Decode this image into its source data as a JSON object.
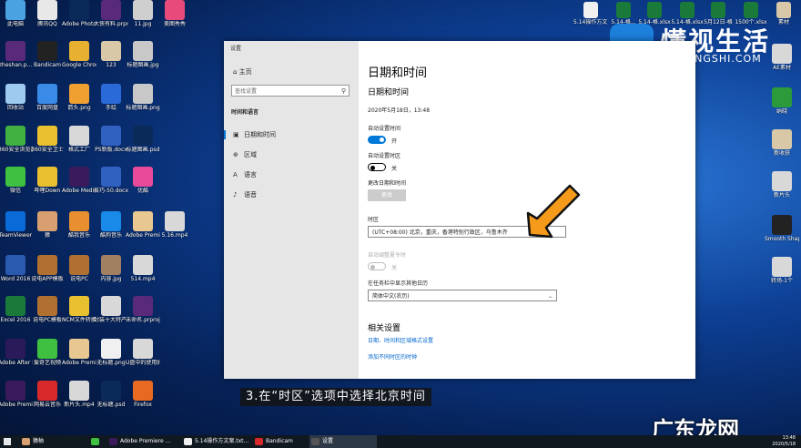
{
  "desktop_icons": [
    {
      "label": "此电脑",
      "color": "#4aa3e0"
    },
    {
      "label": "腾讯QQ",
      "color": "#e8e8e8"
    },
    {
      "label": "Adobe Photosh...",
      "color": "#0a2a5a"
    },
    {
      "label": "大侠有料.prproj",
      "color": "#5a2a7a"
    },
    {
      "label": "11.jpg",
      "color": "#cfcfcf"
    },
    {
      "label": "美图秀秀",
      "color": "#e84a7a"
    },
    {
      "label": "zheshan.p...",
      "color": "#5a2a7a"
    },
    {
      "label": "Bandicam",
      "color": "#222"
    },
    {
      "label": "Google Chrome",
      "color": "#e8b030"
    },
    {
      "label": "123",
      "color": "#d8c8a8"
    },
    {
      "label": "标题图画.jpg",
      "color": "#c8c8c8"
    },
    {
      "label": "回收站",
      "color": "#9ecaf0"
    },
    {
      "label": "百度网盘",
      "color": "#3a8ae8"
    },
    {
      "label": "箭头.png",
      "color": "#f0a030"
    },
    {
      "label": "手绘",
      "color": "#2a6ad8"
    },
    {
      "label": "标题图画.png",
      "color": "#c8c8c8"
    },
    {
      "label": "360安全浏览器",
      "color": "#40b040"
    },
    {
      "label": "360安全卫士",
      "color": "#e8c030"
    },
    {
      "label": "格式工厂",
      "color": "#d8d8d8"
    },
    {
      "label": "PS新版.docx",
      "color": "#3060c0"
    },
    {
      "label": "标题图画.psd",
      "color": "#0a2a5a"
    },
    {
      "label": "微信",
      "color": "#40c040"
    },
    {
      "label": "哔哩Down",
      "color": "#e8c030"
    },
    {
      "label": "Adobe Media...",
      "color": "#3a1a5a"
    },
    {
      "label": "技巧-50.docx",
      "color": "#3060c0"
    },
    {
      "label": "优酷",
      "color": "#e84a9a"
    },
    {
      "label": "TeamViewer",
      "color": "#0a6ad8"
    },
    {
      "label": "猿",
      "color": "#d8a070"
    },
    {
      "label": "酷我音乐",
      "color": "#e89030"
    },
    {
      "label": "酷狗音乐",
      "color": "#1a8ae8"
    },
    {
      "label": "Adobe Premier...",
      "color": "#e8c890"
    },
    {
      "label": "5.16.mp4",
      "color": "#d8d8d8"
    },
    {
      "label": "Word 2016",
      "color": "#2a5ab0"
    },
    {
      "label": "说电APP模板",
      "color": "#b07030"
    },
    {
      "label": "说电PC",
      "color": "#b07030"
    },
    {
      "label": "内容.jpg",
      "color": "#a08060"
    },
    {
      "label": "514.mp4",
      "color": "#d8d8d8"
    },
    {
      "label": "Excel 2016",
      "color": "#1a7a3a"
    },
    {
      "label": "说电PC模板",
      "color": "#b07030"
    },
    {
      "label": "NCM文件转换.exe",
      "color": "#e8c030"
    },
    {
      "label": "封装十大特产.mp4",
      "color": "#d8d8d8"
    },
    {
      "label": "未命名.prproj",
      "color": "#5a2a7a"
    },
    {
      "label": "Adobe After Effects 2020",
      "color": "#2a1a5a"
    },
    {
      "label": "爱奇艺视频",
      "color": "#40c040"
    },
    {
      "label": "Adobe Premier...",
      "color": "#e8c890"
    },
    {
      "label": "无标题.png",
      "color": "#f0f0f0"
    },
    {
      "label": "U盘中的使用好方法...",
      "color": "#d8d8d8"
    },
    {
      "label": "Adobe Premie...",
      "color": "#3a1a5a"
    },
    {
      "label": "网易云音乐",
      "color": "#d82a2a"
    },
    {
      "label": "新片头.mp4",
      "color": "#d8d8d8"
    },
    {
      "label": "无标题.psd",
      "color": "#0a2a5a"
    },
    {
      "label": "Firefox",
      "color": "#e86a20"
    }
  ],
  "right_icons": [
    {
      "label": "5.14操作方文.txt",
      "color": "#f0f0f0"
    },
    {
      "label": "5.14-格...",
      "color": "#1a7a3a"
    },
    {
      "label": "5.14-格.xlsx",
      "color": "#1a7a3a"
    },
    {
      "label": "5.14-格.xlsx",
      "color": "#1a7a3a"
    },
    {
      "label": "5月12日-格",
      "color": "#1a7a3a"
    },
    {
      "label": "1500个.xlsx",
      "color": "#1a7a3a"
    },
    {
      "label": "素材",
      "color": "#d8c8a8"
    },
    {
      "label": "AE素材",
      "color": "#d8d8d8"
    },
    {
      "label": "纳晓",
      "color": "#2a9a3a"
    },
    {
      "label": "新收获",
      "color": "#d8c8a8"
    },
    {
      "label": "新片头",
      "color": "#d8d8d8"
    },
    {
      "label": "Smooth Shapes...",
      "color": "#222"
    },
    {
      "label": "转场-1个",
      "color": "#d8d8d8"
    }
  ],
  "watermark": {
    "title": "懂视生活",
    "subtitle": "51DONGSHI.COM"
  },
  "settings": {
    "window_title": "设置",
    "home": "主页",
    "search_placeholder": "查找设置",
    "category": "时间和语言",
    "nav": [
      {
        "icon": "▣",
        "label": "日期和时间",
        "selected": true
      },
      {
        "icon": "⊕",
        "label": "区域",
        "selected": false
      },
      {
        "icon": "A",
        "label": "语言",
        "selected": false
      },
      {
        "icon": "♪",
        "label": "语音",
        "selected": false
      }
    ],
    "page_title": "日期和时间",
    "section_title": "日期和时间",
    "current_datetime": "2020年5月18日，13:48",
    "auto_time_label": "自动设置时间",
    "auto_time_state": "开",
    "auto_zone_label": "自动设置时区",
    "auto_zone_state": "关",
    "change_label": "更改日期和时间",
    "change_button": "更改",
    "timezone_label": "时区",
    "timezone_value": "(UTC+08:00) 北京，重庆，香港特别行政区，乌鲁木齐",
    "dst_label": "自动调整夏令时",
    "dst_state": "关",
    "calendar_label": "在任务栏中显示其他日历",
    "calendar_value": "简体中文(农历)",
    "related_title": "相关设置",
    "link1": "日期、时间和区域格式设置",
    "link2": "添加不同时区的时钟"
  },
  "caption": "3.在“时区”选项中选择北京时间",
  "brand": "广东龙网",
  "taskbar": {
    "items": [
      {
        "label": "猿柚",
        "color": "#d8a070"
      },
      {
        "label": "",
        "color": "#40c040"
      },
      {
        "label": "Adobe Premiere ...",
        "color": "#3a1a5a"
      },
      {
        "label": "5.14操作方文案.txt...",
        "color": "#f0f0f0"
      },
      {
        "label": "Bandicam",
        "color": "#d82a2a"
      },
      {
        "label": "设置",
        "color": "#555"
      }
    ],
    "time": "13:48",
    "date": "2020/5/18"
  }
}
